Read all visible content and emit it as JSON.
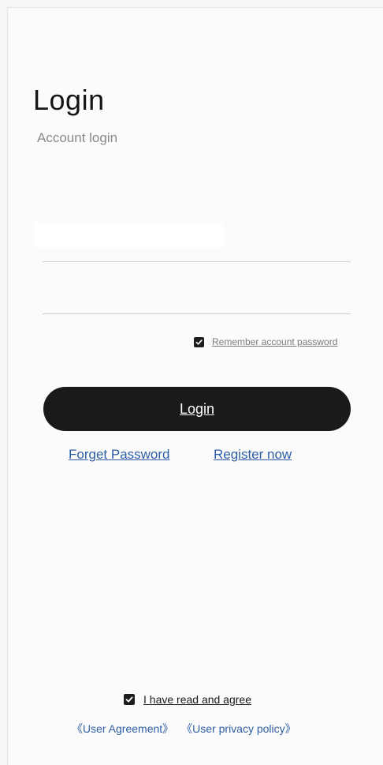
{
  "header": {
    "title": "Login",
    "subtitle": "Account login"
  },
  "form": {
    "username_value": "",
    "username_placeholder": "",
    "password_value": "",
    "password_placeholder": "",
    "remember_label": "Remember account password",
    "remember_checked": true
  },
  "actions": {
    "login_label": "Login",
    "forgot_label": "Forget Password",
    "register_label": "Register now"
  },
  "agreement": {
    "agree_label": "I have read and agree",
    "agree_checked": true,
    "user_agreement_label": "《User Agreement》",
    "privacy_policy_label": "《User privacy policy》"
  },
  "colors": {
    "primary": "#1a1a1a",
    "link": "#2e5fa6",
    "background": "#fbfbfb"
  },
  "icons": {
    "checkbox": "check-icon"
  }
}
